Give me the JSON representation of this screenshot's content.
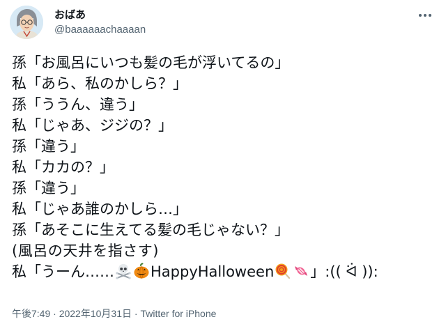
{
  "user": {
    "display_name": "おばあ",
    "handle": "@baaaaaachaaaan"
  },
  "tweet_lines": [
    "孫「お風呂にいつも髪の毛が浮いてるの」",
    "私「あら、私のかしら？」",
    "孫「ううん、違う」",
    "私「じゃあ、ジジの？」",
    "孫「違う」",
    "私「カカの？」",
    "孫「違う」",
    "私「じゃあ誰のかしら…」",
    "孫「あそこに生えてる髪の毛じゃない？」",
    "(風呂の天井を指さす)"
  ],
  "last_line": {
    "prefix": "私「うーん……",
    "emojis": [
      "skull-crossbones-icon",
      "jack-o-lantern-icon"
    ],
    "middle": "HappyHalloween",
    "emojis_after": [
      "lollipop-icon",
      "candy-icon"
    ],
    "suffix": "」:(( ᐛ )):"
  },
  "meta": {
    "time": "午後7:49",
    "separator": " · ",
    "date": "2022年10月31日",
    "separator2": " · ",
    "source": "Twitter for iPhone"
  },
  "colors": {
    "text": "#0f1419",
    "secondary": "#536471",
    "background": "#ffffff"
  }
}
